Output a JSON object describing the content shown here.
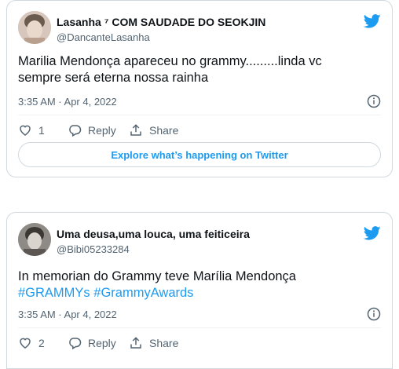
{
  "tweets": [
    {
      "display_name": "Lasanha ⁷ COM SAUDADE DO SEOKJIN",
      "handle": "@DancanteLasanha",
      "text_line1": "Marilia Mendonça apareceu no grammy.........linda vc",
      "text_line2": "sempre será eterna nossa rainha",
      "timestamp": "3:35 AM · Apr 4, 2022",
      "like_count": "1",
      "reply_label": "Reply",
      "share_label": "Share",
      "explore_label": "Explore what’s happening on Twitter"
    },
    {
      "display_name": "Uma deusa,uma louca, uma feiticeira",
      "handle": "@Bibi05233284",
      "text_line1": "In memorian do Grammy teve Marília Mendonça",
      "hashtag1": "#GRAMMYs",
      "hashtag2": "#GrammyAwards",
      "timestamp": "3:35 AM · Apr 4, 2022",
      "like_count": "2",
      "reply_label": "Reply",
      "share_label": "Share"
    }
  ],
  "colors": {
    "twitter_blue": "#1d9bf0",
    "text": "#0f1419",
    "muted": "#536471",
    "border": "#cfd9de"
  },
  "icons": [
    "twitter-bird-icon",
    "info-icon",
    "heart-icon",
    "reply-icon",
    "share-icon"
  ]
}
